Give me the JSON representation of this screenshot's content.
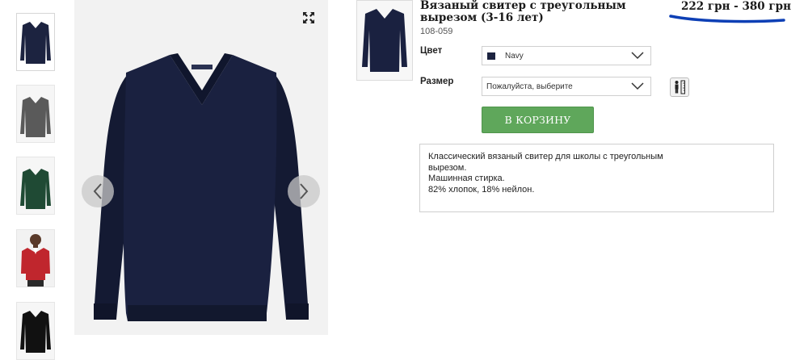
{
  "product": {
    "title": "Вязаный свитер с треугольным вырезом (3-16 лет)",
    "sku": "108-059",
    "price": "222 грн - 380 грн"
  },
  "options": {
    "color_label": "Цвет",
    "color_value": "Navy",
    "color_swatch": "#1c2340",
    "size_label": "Размер",
    "size_value": "Пожалуйста, выберите"
  },
  "cart_button_label": "В КОРЗИНУ",
  "description": {
    "line1": "Классический вязаный свитер для школы с треугольным вырезом.",
    "line2": "Машинная стирка.",
    "line3": "82% хлопок, 18% нейлон."
  },
  "thumbnails": [
    {
      "color": "#1c2340",
      "kind": "navy-sweater"
    },
    {
      "color": "#5a5a5a",
      "kind": "grey-sweater"
    },
    {
      "color": "#1f4a34",
      "kind": "green-sweater"
    },
    {
      "color": "#c0262d",
      "kind": "model-red-sweater"
    },
    {
      "color": "#111111",
      "kind": "black-sweater"
    }
  ],
  "icons": {
    "expand": "expand-icon",
    "prev": "chevron-left-icon",
    "next": "chevron-right-icon",
    "dropdown": "chevron-down-icon",
    "size_guide": "size-guide-icon"
  },
  "colors": {
    "cart_button": "#5fa75b",
    "annotation_underline": "#0d3fb5"
  }
}
